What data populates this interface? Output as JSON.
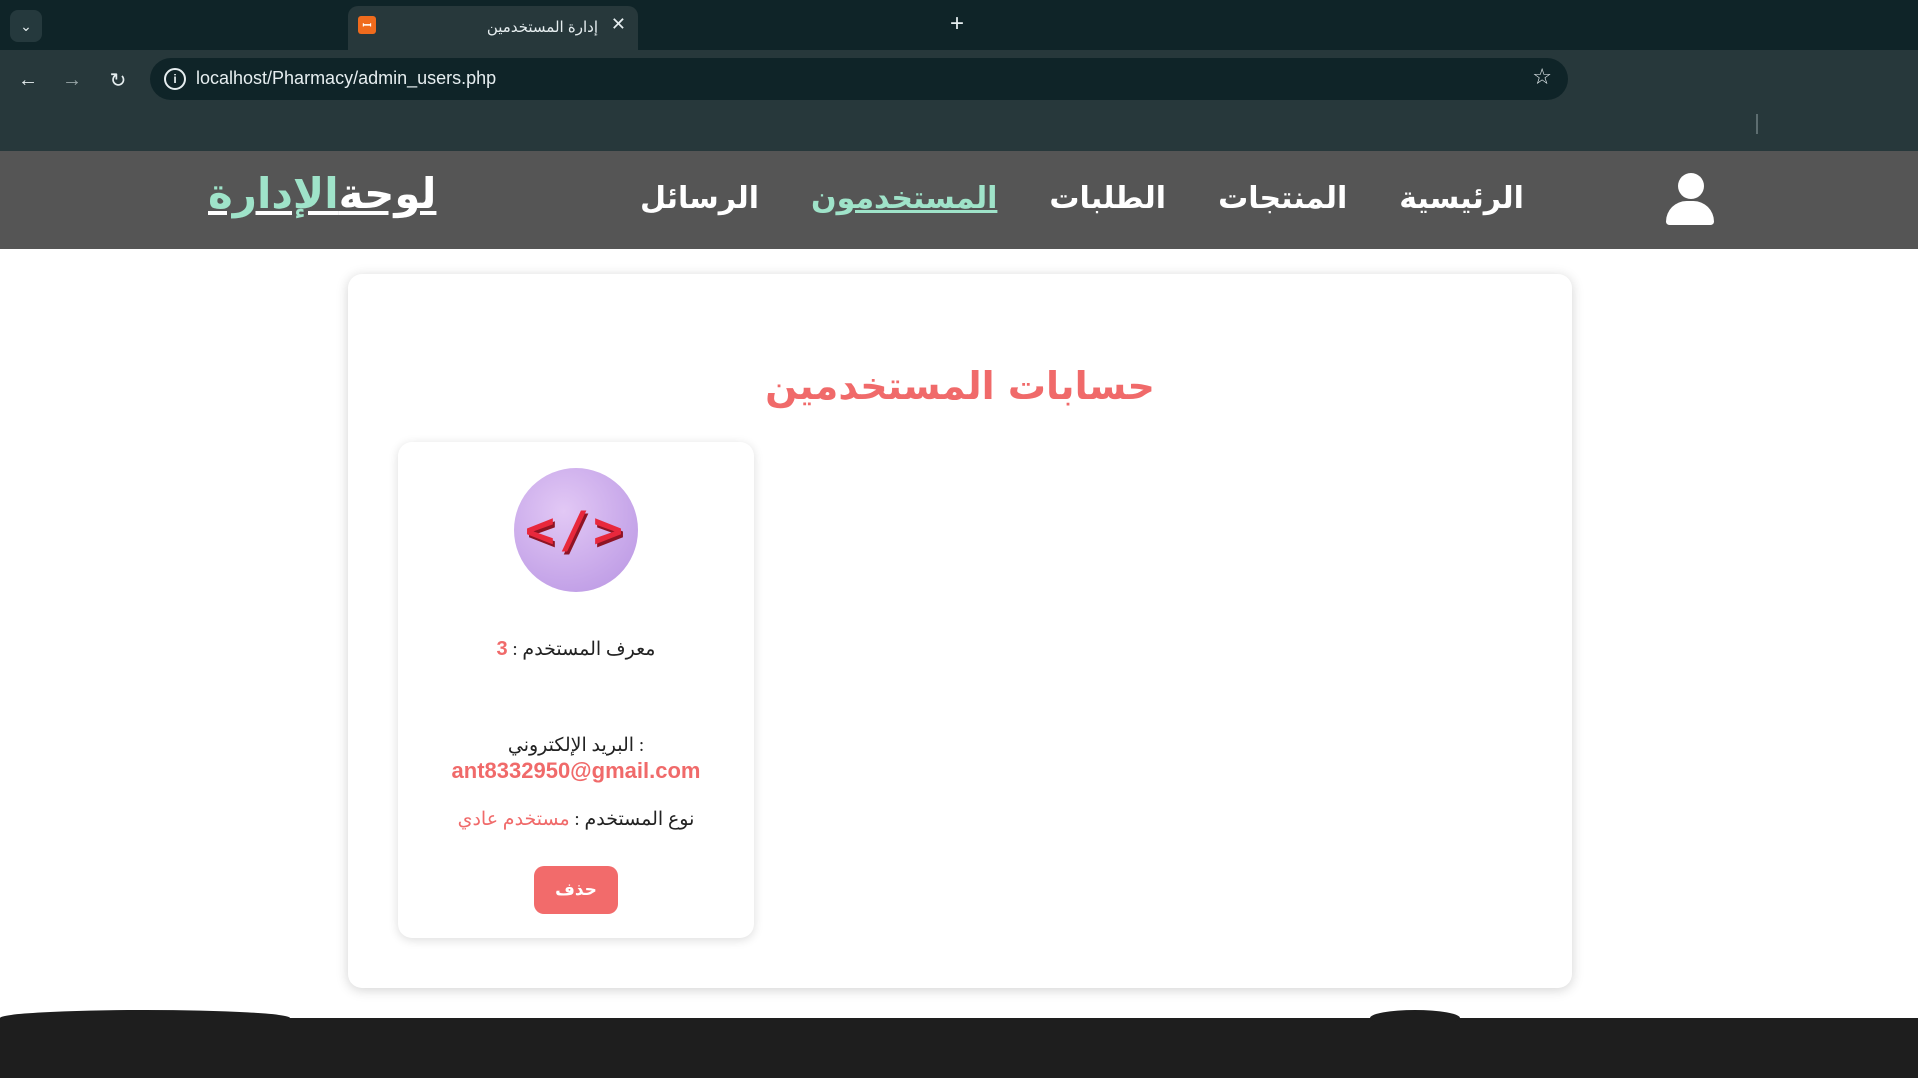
{
  "browser": {
    "tab_title": "إدارة المستخدمين",
    "tab_favicon_text": "ꟷꟷ",
    "tab_close": "✕",
    "new_tab": "+",
    "url": "localhost/Pharmacy/admin_users.php",
    "icons": {
      "menu": "chevron-down-icon",
      "back": "arrow-left-icon",
      "forward": "arrow-right-icon",
      "reload": "reload-icon",
      "info": "info-icon",
      "bookmark": "star-icon"
    }
  },
  "header": {
    "brand_accent": "الإدارة",
    "brand_main": "لوحة",
    "nav": [
      {
        "label": "الرئيسية",
        "active": false
      },
      {
        "label": "المنتجات",
        "active": false
      },
      {
        "label": "الطلبات",
        "active": false
      },
      {
        "label": "المستخدمون",
        "active": true
      },
      {
        "label": "الرسائل",
        "active": false
      }
    ],
    "user_icon": "user-icon"
  },
  "main": {
    "title": "حسابات المستخدمين",
    "user_card": {
      "avatar_text": "</>",
      "id_label": "معرف المستخدم :",
      "id_value": "3",
      "email_label": ": البريد الإلكتروني",
      "email_value": "ant8332950@gmail.com",
      "type_label": "نوع المستخدم :",
      "type_value": "مستخدم عادي",
      "delete_label": "حذف"
    }
  },
  "colors": {
    "accent": "#f06a6a",
    "nav_active": "#9fe3c9",
    "header_bg": "#555555"
  }
}
